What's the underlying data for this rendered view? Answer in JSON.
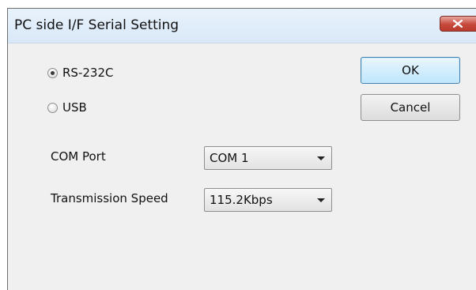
{
  "window": {
    "title": "PC side I/F Serial Setting",
    "close_icon": "close-x-icon"
  },
  "connection": {
    "options": [
      {
        "label": "RS-232C",
        "selected": true
      },
      {
        "label": "USB",
        "selected": false
      }
    ]
  },
  "com_port": {
    "label": "COM Port",
    "value": "COM 1"
  },
  "transmission_speed": {
    "label": "Transmission Speed",
    "value": "115.2Kbps"
  },
  "buttons": {
    "ok": "OK",
    "cancel": "Cancel"
  },
  "colors": {
    "close_button": "#c6493c",
    "default_button": "#bee6fd"
  }
}
